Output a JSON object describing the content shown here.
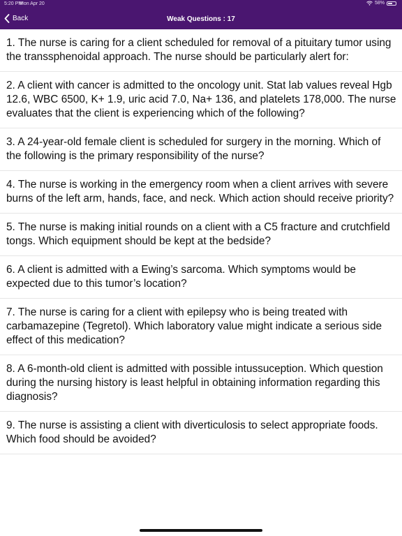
{
  "status_bar": {
    "time": "5:20 PM",
    "date": "Mon Apr 20",
    "battery": "58%",
    "battery_level": 0.58
  },
  "nav": {
    "back_label": "Back",
    "title": "Weak Questions : 17"
  },
  "questions": [
    "1. The nurse is caring for a client scheduled for removal of a pituitary tumor using the transsphenoidal approach. The nurse should be particularly alert for:",
    "2. A client with cancer is admitted to the oncology unit. Stat lab values reveal Hgb 12.6, WBC 6500, K+ 1.9, uric acid 7.0, Na+ 136, and platelets 178,000. The nurse evaluates that the client is experiencing which of the following?",
    "3. A 24-year-old female client is scheduled for surgery in the morning. Which of the following is the primary responsibility of the nurse?",
    "4. The nurse is working in the emergency room when a client arrives with severe burns of the left arm, hands, face, and neck. Which action should receive priority?",
    "5. The nurse is making initial rounds on a client with a C5 fracture and crutchfield tongs. Which equipment should be kept at the bedside?",
    "6. A client is admitted with a Ewing’s sarcoma. Which symptoms would be expected due to this tumor’s location?",
    "7. The nurse is caring for a client with epilepsy who is being treated with carbamazepine (Tegretol). Which laboratory value might indicate a serious side effect of this medication?",
    "8. A 6-month-old client is admitted with possible intussuception. Which question during the nursing history is least helpful in obtaining information regarding this diagnosis?",
    "9. The nurse is assisting a client with diverticulosis to select appropriate foods. Which food should be avoided?"
  ],
  "colors": {
    "header": "#4a1670"
  }
}
